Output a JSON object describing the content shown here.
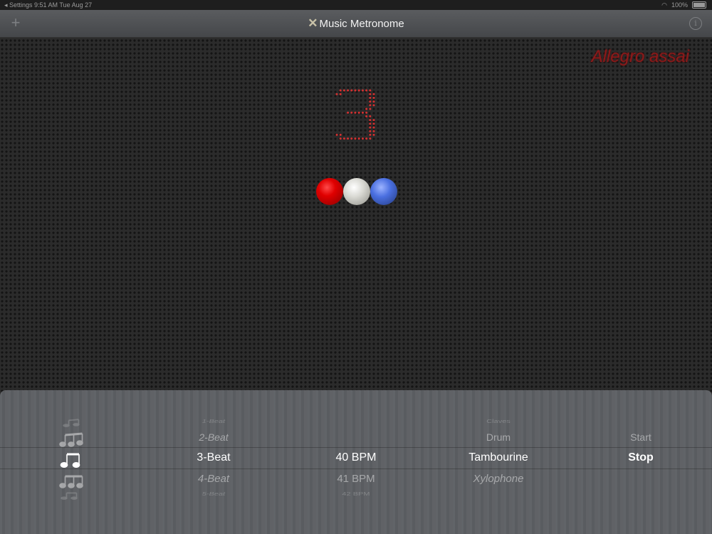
{
  "status_bar": {
    "left": "◂ Settings   9:51 AM   Tue Aug 27",
    "battery": "100%"
  },
  "nav": {
    "title": "Music Metronome",
    "add_icon": "plus-icon",
    "info_icon": "info-icon"
  },
  "display": {
    "tempo_name": "Allegro assai",
    "beat_digit": "3",
    "digit_color": "#d23030",
    "balls": [
      "red",
      "white",
      "blue"
    ]
  },
  "picker": {
    "meter_icons": [
      "eighth-notes-1",
      "eighth-notes-2",
      "eighth-notes-3",
      "eighth-notes-4",
      "eighth-notes-5"
    ],
    "beats": [
      "1-Beat",
      "2-Beat",
      "3-Beat",
      "4-Beat",
      "5-Beat"
    ],
    "bpm": [
      "",
      "",
      "40 BPM",
      "41 BPM",
      "42 BPM"
    ],
    "sounds": [
      "Claves",
      "Drum",
      "Tambourine",
      "Xylophone",
      ""
    ],
    "actions": [
      "Start",
      "Stop"
    ],
    "selected": {
      "beats": "3-Beat",
      "bpm": "40 BPM",
      "sound": "Tambourine",
      "action": "Stop"
    }
  }
}
